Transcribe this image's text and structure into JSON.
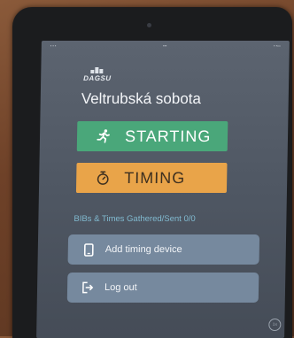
{
  "app": {
    "logo_text": "DAGSU",
    "event_title": "Veltrubská sobota"
  },
  "buttons": {
    "starting_label": "STARTING",
    "timing_label": "TIMING",
    "add_device_label": "Add timing device",
    "logout_label": "Log out"
  },
  "status": {
    "gathered_text": "BIBs & Times Gathered/Sent 0/0"
  },
  "badge": {
    "text": "1x"
  },
  "icons": {
    "starting": "running-person-icon",
    "timing": "stopwatch-icon",
    "device": "phone-icon",
    "logout": "logout-icon"
  },
  "colors": {
    "starting_bg": "#4aa77a",
    "timing_bg": "#e9a449",
    "secondary_bg": "#76899e",
    "stats_text": "#80b9cf"
  }
}
